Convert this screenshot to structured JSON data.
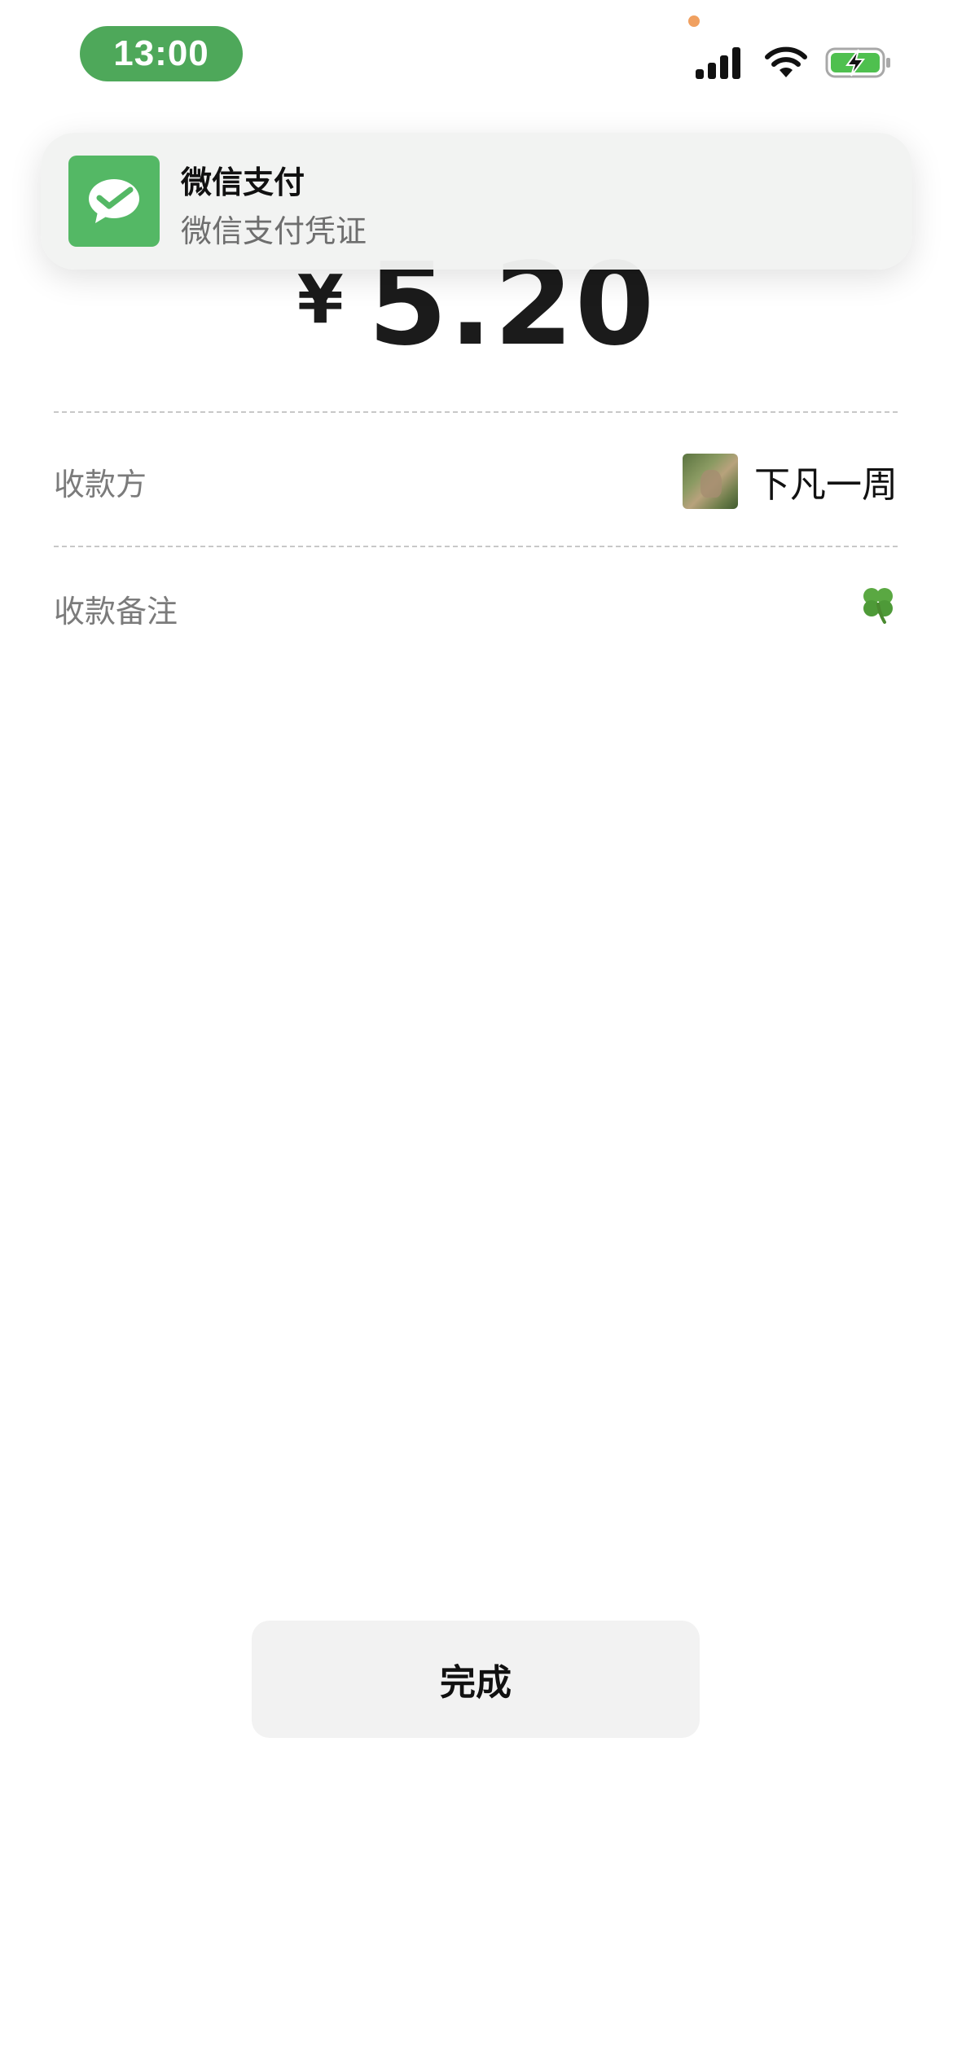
{
  "status_bar": {
    "time": "13:00",
    "accent_color": "#4ea85a",
    "icons": [
      "cellular-signal-icon",
      "wifi-icon",
      "battery-charging-icon"
    ]
  },
  "notification": {
    "app_name": "微信支付",
    "message": "微信支付凭证",
    "icon": "wechat-pay-icon",
    "icon_color": "#54b865"
  },
  "payment": {
    "currency_symbol": "¥",
    "amount": "5.20"
  },
  "details": {
    "payee_label": "收款方",
    "payee_name": "下凡一周",
    "memo_label": "收款备注",
    "memo_icon": "four-leaf-clover-icon"
  },
  "actions": {
    "done_label": "完成"
  }
}
